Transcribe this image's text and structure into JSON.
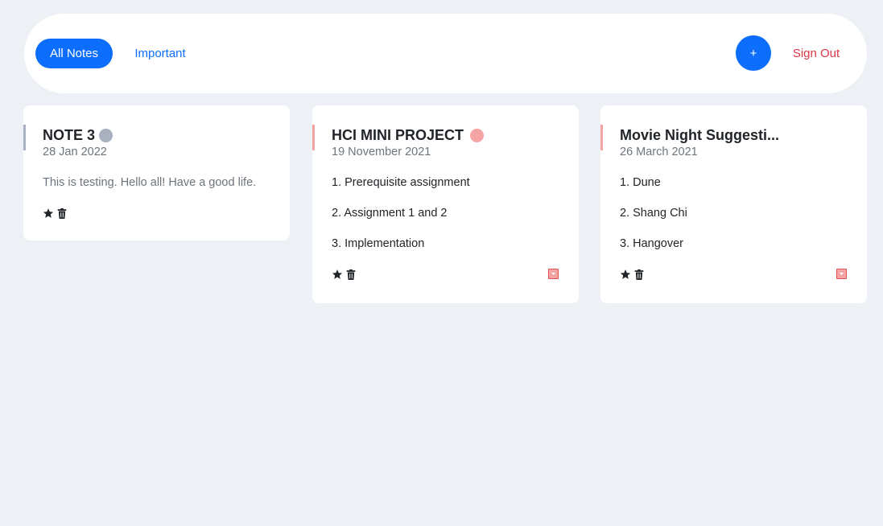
{
  "nav": {
    "all_notes_label": "All Notes",
    "important_label": "Important",
    "add_label": "+",
    "sign_out_label": "Sign Out"
  },
  "colors": {
    "primary": "#0d6efd",
    "danger": "#dc3545",
    "tag_grey": "#a9b1c1",
    "tag_red": "#f5a3a3"
  },
  "notes": [
    {
      "title": "NOTE 3",
      "date": "28 Jan 2022",
      "tag_color": "#a9b1c1",
      "body": "This is testing. Hello all! Have a good life.",
      "lines": [],
      "icons": [
        "star-icon",
        "trash-icon"
      ]
    },
    {
      "title": "HCI MINI PROJECT",
      "date": "19 November 2021",
      "tag_color": "#f5a3a3",
      "lines": [
        "1. Prerequisite assignment",
        "2. Assignment 1 and 2",
        "3. Implementation"
      ],
      "icons": [
        "star-icon",
        "trash-icon",
        "expand-icon"
      ]
    },
    {
      "title": "Movie Night Suggesti...",
      "date": "26 March 2021",
      "tag_color": "#f5a3a3",
      "lines": [
        "1. Dune",
        "2. Shang Chi",
        "3. Hangover"
      ],
      "icons": [
        "star-icon",
        "trash-icon",
        "expand-icon"
      ]
    }
  ]
}
